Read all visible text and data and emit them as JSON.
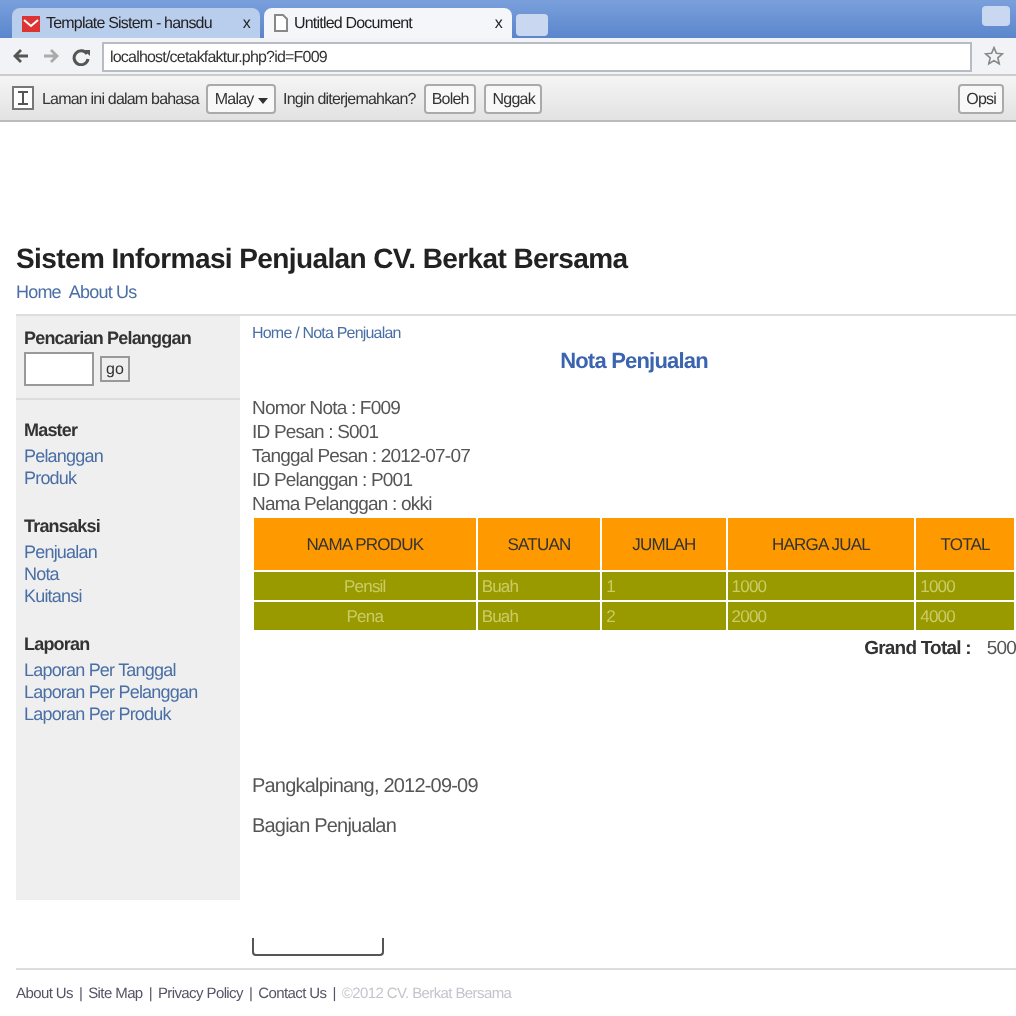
{
  "browser": {
    "tabs": [
      {
        "label": "Template Sistem - hansdu",
        "close": "x",
        "selected": false
      },
      {
        "label": "Untitled Document",
        "close": "x",
        "selected": true
      }
    ],
    "address": "localhost/cetakfaktur.php?id=F009"
  },
  "translate_bar": {
    "message": "Laman ini dalam bahasa",
    "language": "Malay",
    "question": "Ingin diterjemahkan?",
    "buttons": [
      "Boleh",
      "Nggak"
    ],
    "options": "Opsi"
  },
  "page": {
    "title": "Sistem Informasi Penjualan CV. Berkat Bersama",
    "top_nav": [
      "Home",
      "About Us"
    ],
    "sidebar": {
      "search": {
        "label": "Pencarian Pelanggan",
        "button": "go"
      },
      "sections": [
        {
          "heading": "Master",
          "links": [
            "Pelanggan",
            "Produk"
          ]
        },
        {
          "heading": "Transaksi",
          "links": [
            "Penjualan",
            "Nota",
            "Kuitansi"
          ]
        },
        {
          "heading": "Laporan",
          "links": [
            "Laporan Per Tanggal",
            "Laporan Per Pelanggan",
            "Laporan Per Produk"
          ]
        }
      ]
    },
    "breadcrumb": "Home / Nota Penjualan",
    "heading": "Nota Penjualan",
    "details": [
      "Nomor Nota : F009",
      "ID Pesan : S001",
      "Tanggal Pesan : 2012-07-07",
      "ID Pelanggan : P001",
      "Nama Pelanggan : okki"
    ],
    "table": {
      "columns": [
        "NAMA PRODUK",
        "SATUAN",
        "JUMLAH",
        "HARGA JUAL",
        "TOTAL"
      ],
      "rows": [
        [
          "Pensil",
          "Buah",
          "1",
          "1000",
          "1000"
        ],
        [
          "Pena",
          "Buah",
          "2",
          "2000",
          "4000"
        ]
      ]
    },
    "grand_total": {
      "label": "Grand Total :",
      "value": "500"
    },
    "place_date": "Pangkalpinang, 2012-09-09",
    "signatory": "Bagian Penjualan"
  },
  "footer": {
    "links": [
      "About Us",
      "Site Map",
      "Privacy Policy",
      "Contact Us"
    ],
    "separator": "|",
    "copyright": "©2012 CV. Berkat Bersama"
  }
}
